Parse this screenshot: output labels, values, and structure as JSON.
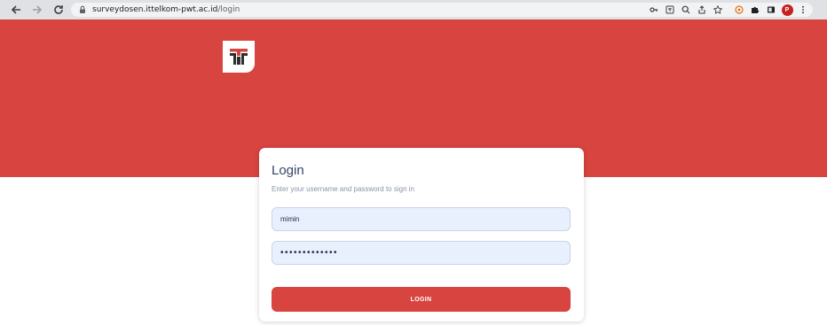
{
  "browser": {
    "url_host": "surveydosen.ittelkom-pwt.ac.id",
    "url_path": "/login",
    "profile_initial": "P"
  },
  "login": {
    "title": "Login",
    "subtitle": "Enter your username and password to sign in",
    "username_value": "mimin",
    "password_mask": "•••••••••••••",
    "button_label": "LOGIN"
  },
  "colors": {
    "brand_red": "#d84440",
    "input_bg": "#e8f0fe"
  },
  "icons": [
    "back-icon",
    "forward-icon",
    "reload-icon",
    "lock-icon",
    "key-icon",
    "translate-icon",
    "zoom-icon",
    "share-icon",
    "bookmark-star-icon",
    "extension-icon",
    "puzzle-icon",
    "sidepanel-icon",
    "menu-icon",
    "telkom-logo-icon"
  ]
}
